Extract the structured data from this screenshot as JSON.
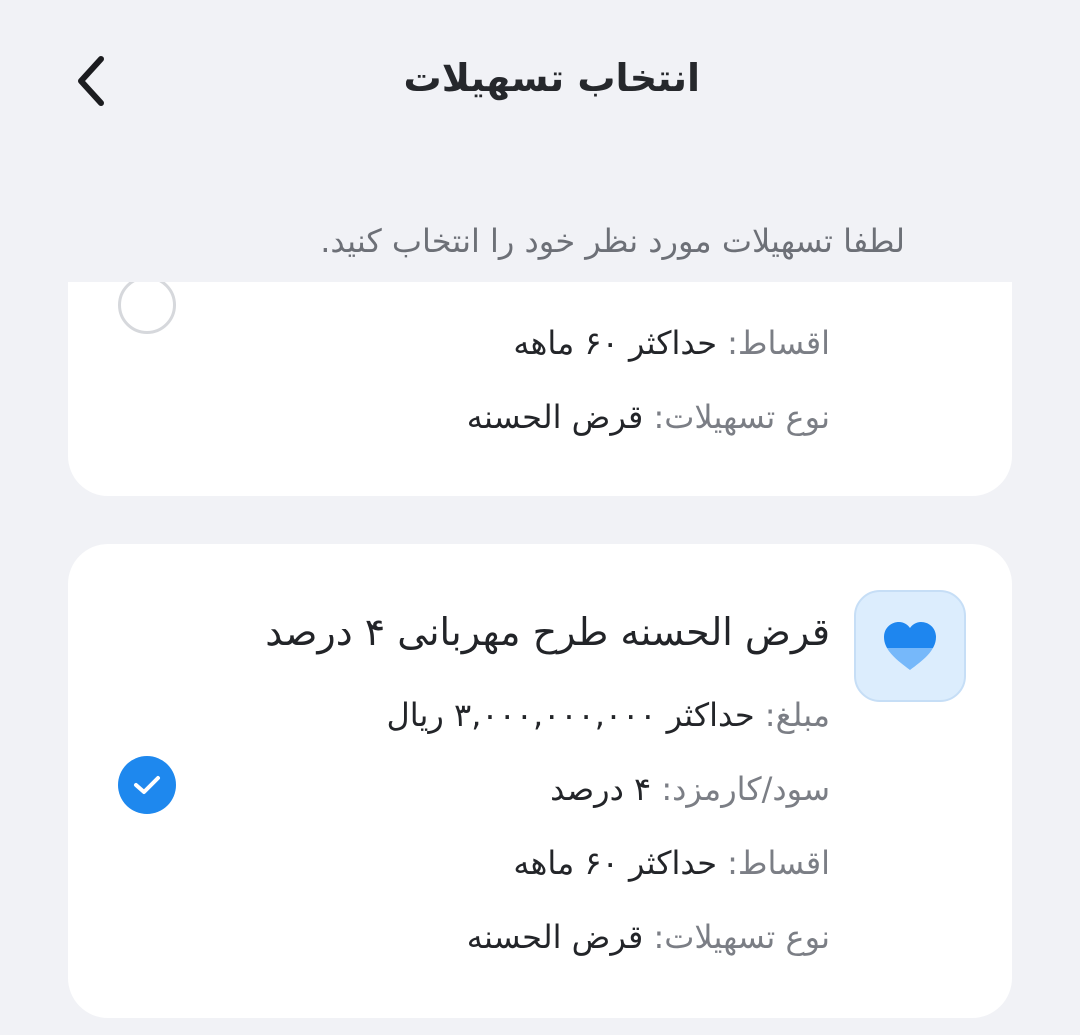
{
  "header": {
    "title": "انتخاب تسهیلات"
  },
  "subtitle": "لطفا تسهیلات مورد نظر خود را انتخاب کنید.",
  "colors": {
    "background": "#f1f2f6",
    "card": "#ffffff",
    "accent": "#1e88ee",
    "icon_bg": "#dcedfd"
  },
  "cards": [
    {
      "icon": "heart-icon",
      "selected": false,
      "rows": [
        {
          "label": "اقساط:",
          "value": "حداکثر ۶۰ ماهه"
        },
        {
          "label": "نوع تسهیلات:",
          "value": "قرض الحسنه"
        }
      ]
    },
    {
      "icon": "heart-icon",
      "selected": true,
      "title": "قرض الحسنه طرح مهربانی ۴ درصد",
      "rows": [
        {
          "label": "مبلغ:",
          "value": "حداکثر ۳,۰۰۰,۰۰۰,۰۰۰ ریال"
        },
        {
          "label": "سود/کارمزد:",
          "value": "۴ درصد"
        },
        {
          "label": "اقساط:",
          "value": "حداکثر ۶۰ ماهه"
        },
        {
          "label": "نوع تسهیلات:",
          "value": "قرض الحسنه"
        }
      ]
    }
  ]
}
